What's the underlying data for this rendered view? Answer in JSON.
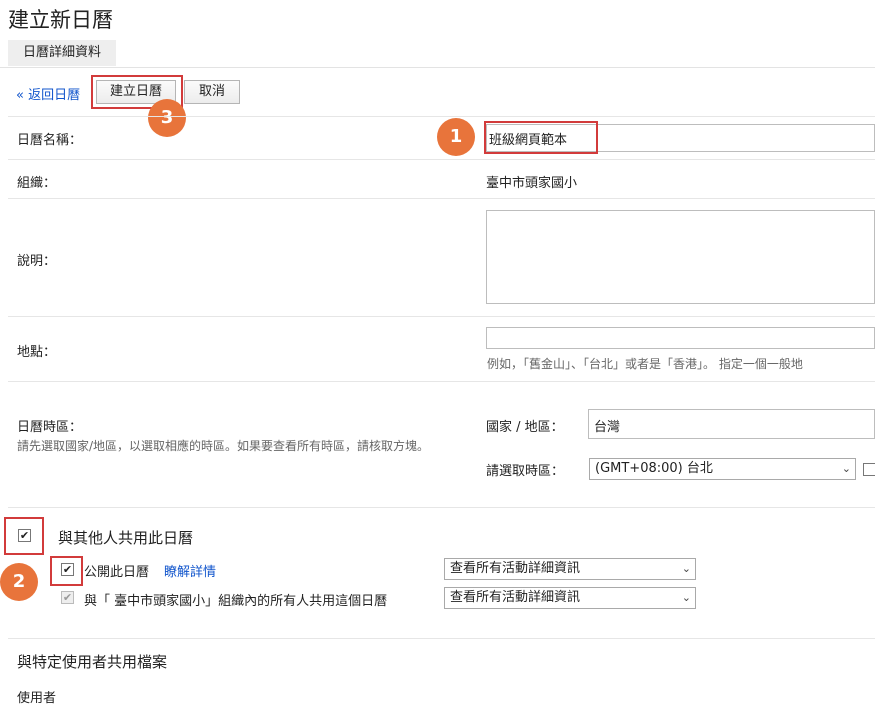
{
  "header": {
    "title": "建立新日曆",
    "tab": "日曆詳細資料"
  },
  "toolbar": {
    "back": "« 返回日曆",
    "create": "建立日曆",
    "cancel": "取消"
  },
  "badges": {
    "one": "1",
    "two": "2",
    "three": "3"
  },
  "form": {
    "name_label": "日曆名稱：",
    "name_value": "班級網頁範本",
    "org_label": "組織：",
    "org_value": "臺中市頭家國小",
    "desc_label": "說明：",
    "location_label": "地點：",
    "location_hint": "例如，「舊金山」、「台北」或者是「香港」。 指定一個一般地",
    "timezone_label": "日曆時區：",
    "timezone_hint": "請先選取國家/地區，以選取相應的時區。如果要查看所有時區，請核取方塊。",
    "country_label": "國家 / 地區：",
    "country_value": "台灣",
    "tz_select_label": "請選取時區：",
    "tz_select_value": "(GMT+08:00) 台北"
  },
  "sharing": {
    "share_label": "與其他人共用此日曆",
    "share_checked": true,
    "public_label": "公開此日曆",
    "learn_more": "瞭解詳情",
    "public_checked": true,
    "public_select": "查看所有活動詳細資訊",
    "org_share_label": "與「 臺中市頭家國小」組織內的所有人共用這個日曆",
    "org_checked": true,
    "org_select": "查看所有活動詳細資訊"
  },
  "specific": {
    "title": "與特定使用者共用檔案",
    "user_label": "使用者"
  },
  "colors": {
    "accent": "#e8743b",
    "highlight": "#d23b3b",
    "link": "#1155cc"
  }
}
